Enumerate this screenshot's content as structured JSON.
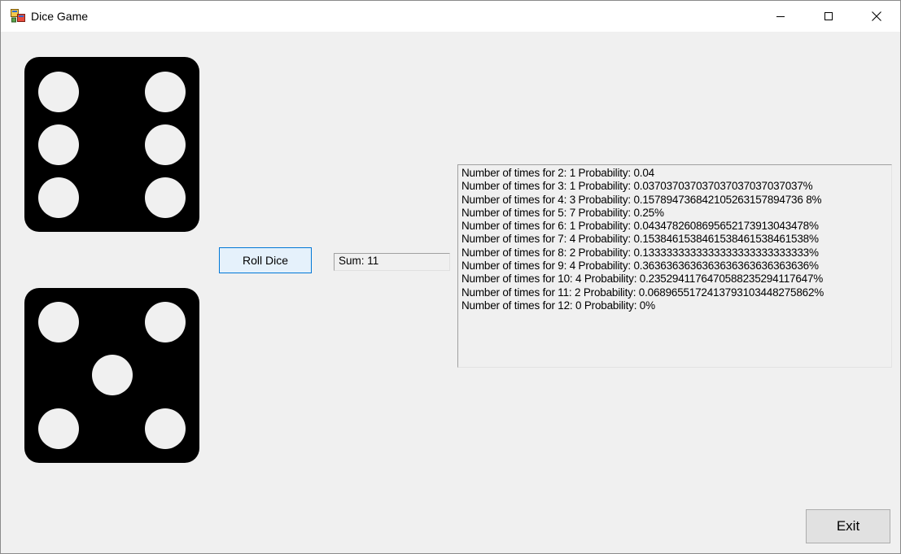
{
  "window": {
    "title": "Dice Game",
    "app_icon": "winforms-app-icon",
    "controls": [
      "minimize-icon",
      "maximize-icon",
      "close-icon"
    ]
  },
  "dice": [
    {
      "value": 6
    },
    {
      "value": 5
    }
  ],
  "roll_button": {
    "label": "Roll Dice"
  },
  "sum": {
    "text": "Sum: 11"
  },
  "results": {
    "lines": [
      "Number of times for 2: 1 Probability: 0.04",
      "Number of times for 3: 1 Probability: 0.037037037037037037037037037%",
      "Number of times for 4: 3 Probability: 0.157894736842105263157894736 8%",
      "Number of times for 5: 7 Probability: 0.25%",
      "Number of times for 6: 1 Probability: 0.0434782608695652173913043478%",
      "Number of times for 7: 4 Probability: 0.1538461538461538461538461538%",
      "Number of times for 8: 2 Probability: 0.1333333333333333333333333333%",
      "Number of times for 9: 4 Probability: 0.3636363636363636363636363636%",
      "Number of times for 10: 4 Probability: 0.2352941176470588235294117647%",
      "Number of times for 11: 2 Probability: 0.0689655172413793103448275862%",
      "Number of times for 12: 0 Probability: 0%"
    ]
  },
  "exit_button": {
    "label": "Exit"
  },
  "colors": {
    "form_background": "#f0f0f0",
    "die_body": "#000000",
    "die_pip": "#f0f0f0",
    "focus_border": "#0078d7"
  }
}
